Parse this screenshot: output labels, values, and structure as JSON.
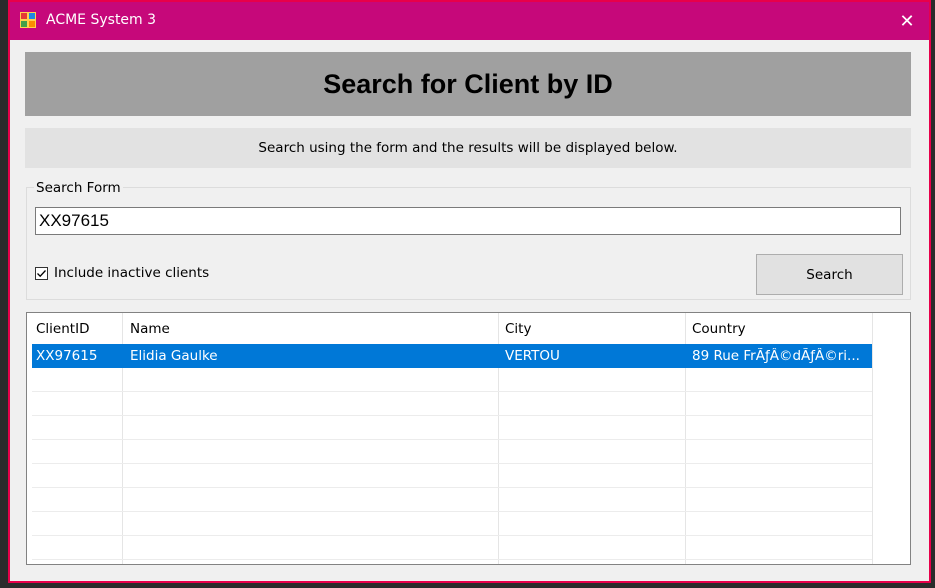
{
  "window": {
    "title": "ACME System 3",
    "close_glyph": "✕"
  },
  "header": {
    "title": "Search for Client by ID"
  },
  "info": {
    "text": "Search using the form and the results will be displayed below."
  },
  "search_form": {
    "legend": "Search Form",
    "input_value": "XX97615",
    "include_inactive_label": "Include inactive clients",
    "include_inactive_checked": true,
    "search_button_label": "Search"
  },
  "results": {
    "columns": [
      "ClientID",
      "Name",
      "City",
      "Country"
    ],
    "rows": [
      {
        "client_id": "XX97615",
        "name": "Elidia Gaulke",
        "city": "VERTOU",
        "country": "89 Rue FrÃƒÂ©dÃƒÂ©ri...",
        "selected": true
      }
    ]
  },
  "colors": {
    "titlebar": "#c6087a",
    "border": "#e8004a",
    "selection": "#0078d7"
  }
}
